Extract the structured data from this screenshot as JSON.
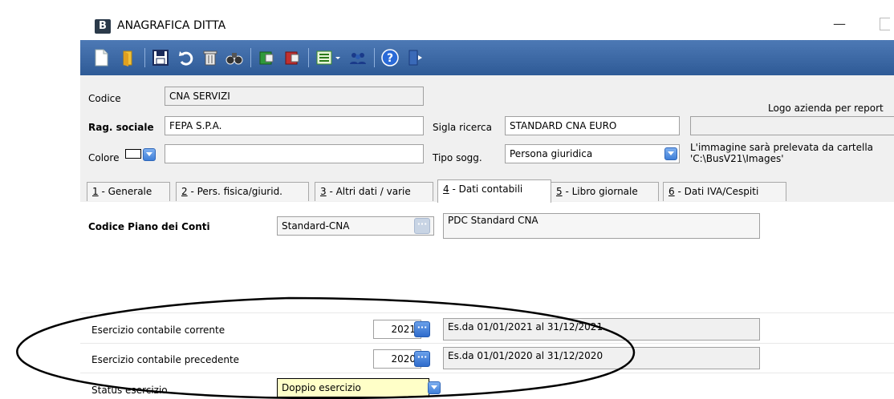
{
  "window": {
    "app_icon_letter": "B",
    "title": "ANAGRAFICA DITTA",
    "minimize_glyph": "—"
  },
  "toolbar": {
    "icons": [
      "new-document-icon",
      "open-folder-icon",
      "save-icon",
      "undo-icon",
      "delete-icon",
      "find-icon",
      "book-green-icon",
      "book-red-icon",
      "list-options-icon",
      "users-icon",
      "help-icon",
      "exit-icon"
    ]
  },
  "form": {
    "codice_label": "Codice",
    "codice_value": "CNA SERVIZI",
    "rag_sociale_label": "Rag. sociale",
    "rag_sociale_value": "FEPA S.P.A.",
    "colore_label": "Colore",
    "colore_value": "",
    "sigla_label": "Sigla ricerca",
    "sigla_value": "STANDARD CNA EURO",
    "tipo_label": "Tipo sogg.",
    "tipo_value": "Persona giuridica",
    "logo_label": "Logo azienda per report",
    "logo_value": "",
    "logo_note_line1": "L'immagine sarà prelevata da cartella",
    "logo_note_line2": "'C:\\BusV21\\Images'"
  },
  "tabs": [
    {
      "key": "1",
      "label": " - Generale"
    },
    {
      "key": "2",
      "label": " - Pers. fisica/giurid."
    },
    {
      "key": "3",
      "label": " - Altri dati / varie"
    },
    {
      "key": "4",
      "label": " - Dati contabili"
    },
    {
      "key": "5",
      "label": " - Libro giornale"
    },
    {
      "key": "6",
      "label": " - Dati IVA/Cespiti"
    }
  ],
  "active_tab": "4",
  "content": {
    "piano_label": "Codice Piano dei Conti",
    "piano_code": "Standard-CNA",
    "piano_desc": "PDC Standard CNA",
    "corrente_label": "Esercizio contabile corrente",
    "corrente_year": "2021",
    "corrente_desc": "Es.da 01/01/2021 al 31/12/2021",
    "precedente_label": "Esercizio contabile precedente",
    "precedente_year": "2020",
    "precedente_desc": "Es.da 01/01/2020 al 31/12/2020",
    "status_label": "Status esercizio",
    "status_value": "Doppio esercizio"
  },
  "colors": {
    "toolbar_top": "#4d79b5",
    "toolbar_bottom": "#2e5a96",
    "status_highlight": "#ffffc8",
    "annotation_ellipse": "#000000"
  }
}
